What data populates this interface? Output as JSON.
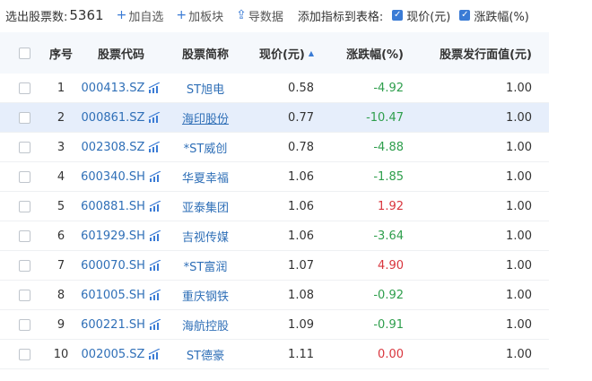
{
  "toolbar": {
    "count_label": "选出股票数:",
    "count": "5361",
    "add_watch": "加自选",
    "add_block": "加板块",
    "export": "导数据",
    "add_metric_label": "添加指标到表格:",
    "check_price": "现价(元)",
    "check_change": "涨跌幅(%)"
  },
  "columns": {
    "index": "序号",
    "code": "股票代码",
    "name": "股票简称",
    "price": "现价(元)",
    "change": "涨跌幅(%)",
    "face_value": "股票发行面值(元)"
  },
  "rows": [
    {
      "idx": "1",
      "code": "000413.SZ",
      "name": "ST旭电",
      "price": "0.58",
      "change": "-4.92",
      "face": "1.00"
    },
    {
      "idx": "2",
      "code": "000861.SZ",
      "name": "海印股份",
      "price": "0.77",
      "change": "-10.47",
      "face": "1.00"
    },
    {
      "idx": "3",
      "code": "002308.SZ",
      "name": "*ST威创",
      "price": "0.78",
      "change": "-4.88",
      "face": "1.00"
    },
    {
      "idx": "4",
      "code": "600340.SH",
      "name": "华夏幸福",
      "price": "1.06",
      "change": "-1.85",
      "face": "1.00"
    },
    {
      "idx": "5",
      "code": "600881.SH",
      "name": "亚泰集团",
      "price": "1.06",
      "change": "1.92",
      "face": "1.00"
    },
    {
      "idx": "6",
      "code": "601929.SH",
      "name": "吉视传媒",
      "price": "1.06",
      "change": "-3.64",
      "face": "1.00"
    },
    {
      "idx": "7",
      "code": "600070.SH",
      "name": "*ST富润",
      "price": "1.07",
      "change": "4.90",
      "face": "1.00"
    },
    {
      "idx": "8",
      "code": "601005.SH",
      "name": "重庆钢铁",
      "price": "1.08",
      "change": "-0.92",
      "face": "1.00"
    },
    {
      "idx": "9",
      "code": "600221.SH",
      "name": "海航控股",
      "price": "1.09",
      "change": "-0.91",
      "face": "1.00"
    },
    {
      "idx": "10",
      "code": "002005.SZ",
      "name": "ST德豪",
      "price": "1.11",
      "change": "0.00",
      "face": "1.00"
    }
  ],
  "colors": {
    "accent": "#3a7bd5",
    "up": "#d9363e",
    "down": "#2e9e4c",
    "row_highlight": "#e6eefb"
  }
}
